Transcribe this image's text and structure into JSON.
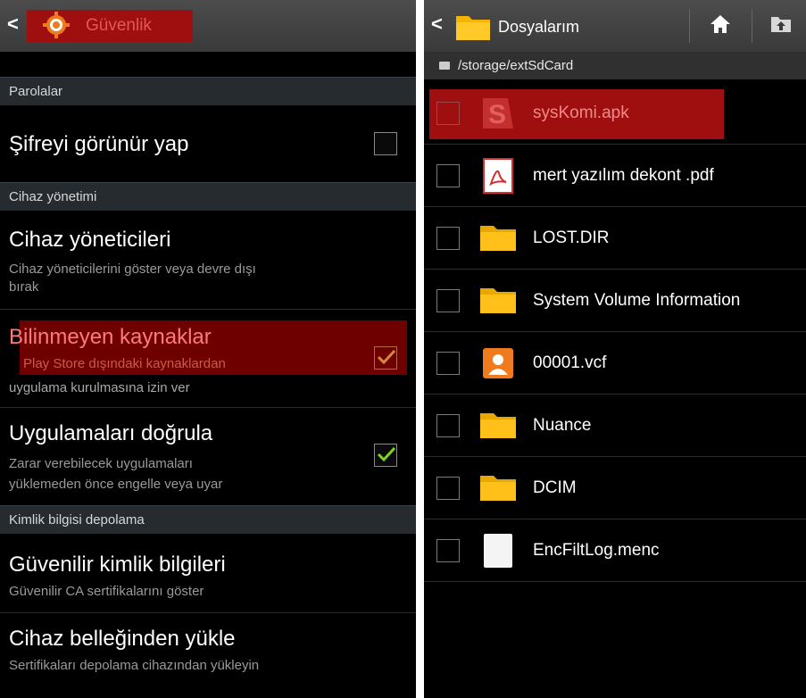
{
  "left": {
    "header_title": "Güvenlik",
    "sections": {
      "passwords": "Parolalar",
      "device_admin": "Cihaz yönetimi",
      "credential_storage": "Kimlik bilgisi depolama"
    },
    "items": {
      "show_password": {
        "title": "Şifreyi görünür yap",
        "checked": false
      },
      "device_admins": {
        "title": "Cihaz yöneticileri",
        "sub1": "Cihaz yöneticilerini göster veya devre dışı",
        "sub2": "bırak"
      },
      "unknown_sources": {
        "title": "Bilinmeyen kaynaklar",
        "sub1": "Play Store dışındaki kaynaklardan",
        "sub2": "uygulama kurulmasına izin ver",
        "checked": true
      },
      "verify_apps": {
        "title": "Uygulamaları doğrula",
        "sub1": "Zarar verebilecek uygulamaları",
        "sub2": "yüklemeden önce engelle veya uyar",
        "checked": true
      },
      "trusted_credentials": {
        "title": "Güvenilir kimlik bilgileri",
        "sub1": "Güvenilir CA sertifikalarını göster"
      },
      "install_from_storage": {
        "title": "Cihaz belleğinden yükle",
        "sub1": "Sertifikaları depolama cihazından yükleyin"
      }
    }
  },
  "right": {
    "header_title": "Dosyalarım",
    "path": "/storage/extSdCard",
    "files": [
      {
        "name": "sysKomi.apk",
        "icon": "apk-icon"
      },
      {
        "name": "mert yazılım dekont .pdf",
        "icon": "pdf-icon"
      },
      {
        "name": "LOST.DIR",
        "icon": "folder-icon"
      },
      {
        "name": "System Volume Information",
        "icon": "folder-icon"
      },
      {
        "name": "00001.vcf",
        "icon": "contact-icon"
      },
      {
        "name": "Nuance",
        "icon": "folder-icon"
      },
      {
        "name": "DCIM",
        "icon": "folder-icon"
      },
      {
        "name": "EncFiltLog.menc",
        "icon": "file-icon"
      }
    ]
  },
  "colors": {
    "highlight": "#a00f0f",
    "check_green": "#7ed321",
    "folder": "#f5b400"
  }
}
